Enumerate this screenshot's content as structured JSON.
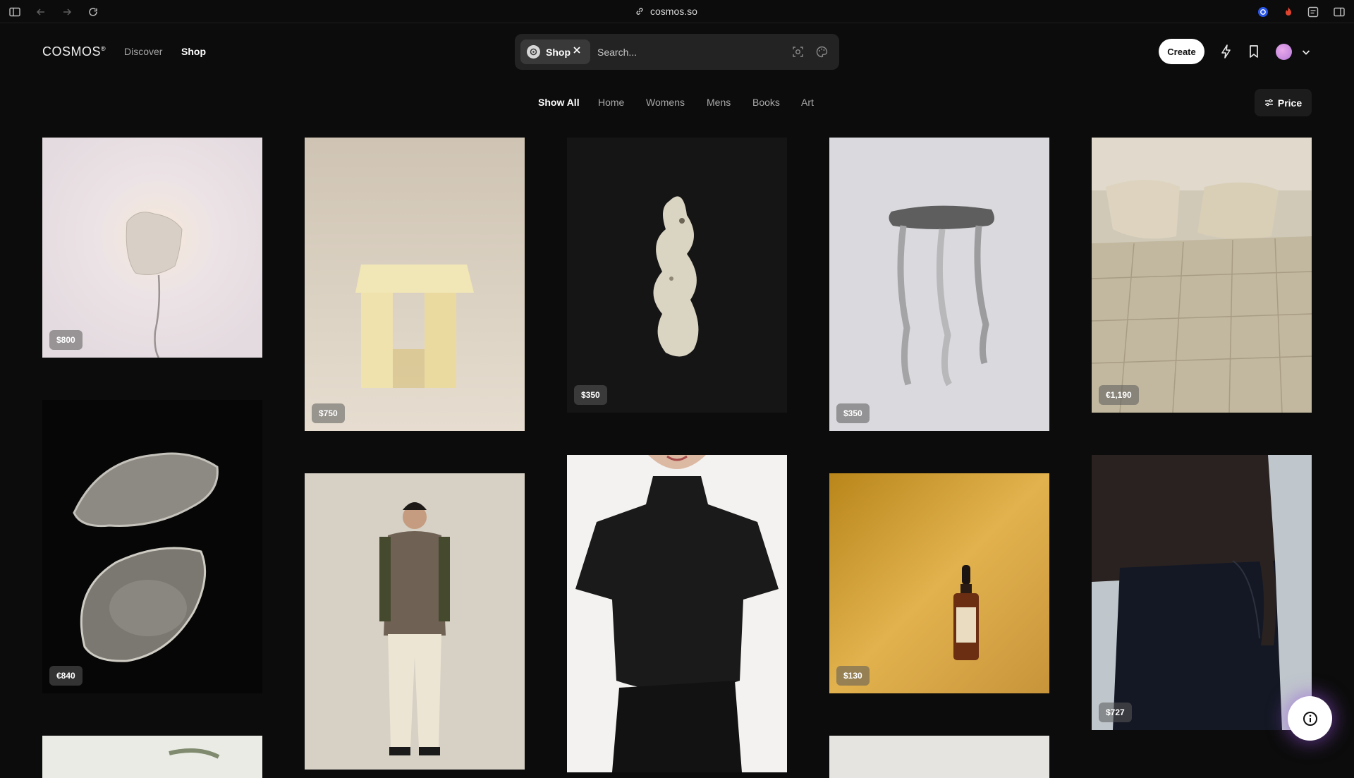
{
  "browser": {
    "url": "cosmos.so"
  },
  "header": {
    "logo": "COSMOS",
    "logo_mark": "®",
    "nav": [
      {
        "label": "Discover"
      },
      {
        "label": "Shop"
      }
    ],
    "search": {
      "chip_label": "Shop",
      "placeholder": "Search..."
    },
    "create_label": "Create"
  },
  "categories": [
    {
      "label": "Show All"
    },
    {
      "label": "Home"
    },
    {
      "label": "Womens"
    },
    {
      "label": "Mens"
    },
    {
      "label": "Books"
    },
    {
      "label": "Art"
    }
  ],
  "filter": {
    "price_label": "Price"
  },
  "products": [
    {
      "price": "$800"
    },
    {
      "price": "$750"
    },
    {
      "price": "$350"
    },
    {
      "price": "$350"
    },
    {
      "price": "€1,190"
    },
    {
      "price": "€840"
    },
    {
      "price": "$130"
    },
    {
      "price": "$727"
    }
  ]
}
